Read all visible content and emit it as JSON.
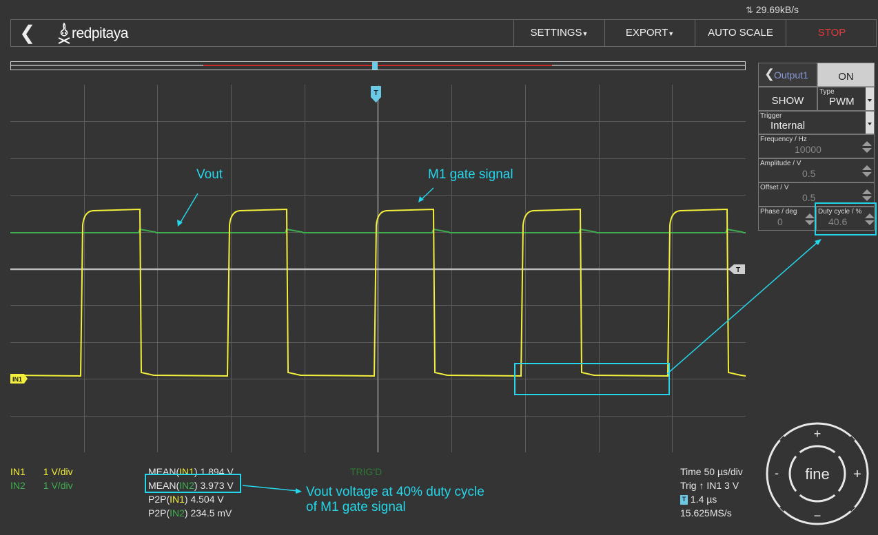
{
  "status": {
    "speed": "29.69kB/s"
  },
  "header": {
    "brand": "redpitaya",
    "settings": "SETTINGS",
    "export": "EXPORT",
    "autoscale": "AUTO SCALE",
    "stop": "STOP"
  },
  "scope": {
    "trigger_marker": "T",
    "trigger_level_marker": "T",
    "channel_marker": "IN1",
    "annotations": {
      "vout": "Vout",
      "gate": "M1 gate signal"
    }
  },
  "panel": {
    "output_label": "Output1",
    "on_label": "ON",
    "show_label": "SHOW",
    "type_label": "Type",
    "type_value": "PWM",
    "trigger_label": "Trigger",
    "trigger_value": "Internal",
    "frequency_label": "Frequency / Hz",
    "frequency_value": "10000",
    "amplitude_label": "Amplitude / V",
    "amplitude_value": "0.5",
    "offset_label": "Offset / V",
    "offset_value": "0.5",
    "phase_label": "Phase / deg",
    "phase_value": "0",
    "duty_label": "Duty cycle / %",
    "duty_value": "40.6"
  },
  "channels": [
    {
      "name": "IN1",
      "scale": "1 V/div",
      "color": "#f4ef3b"
    },
    {
      "name": "IN2",
      "scale": "1 V/div",
      "color": "#3fae4f"
    }
  ],
  "measurements": {
    "mean_in1_prefix": "MEAN(",
    "mean_in1_ch": "IN1",
    "mean_in1_value": ") 1.894 V",
    "mean_in2_prefix": "MEAN(",
    "mean_in2_ch": "IN2",
    "mean_in2_value": ") 3.973 V",
    "p2p_in1_prefix": "P2P(",
    "p2p_in1_ch": "IN1",
    "p2p_in1_value": ") 4.504 V",
    "p2p_in2_prefix": "P2P(",
    "p2p_in2_ch": "IN2",
    "p2p_in2_value": ") 234.5 mV"
  },
  "trig_status": "TRIG'D",
  "timebase": {
    "time": "Time 50 µs/div",
    "trig": "Trig ↑ IN1 3 V",
    "offset": "1.4 µs",
    "samplerate": "15.625MS/s",
    "offset_marker": "T"
  },
  "annotation_note": {
    "line1": "Vout voltage at 40% duty cycle",
    "line2": "of M1 gate signal"
  },
  "dial": {
    "center": "fine",
    "plus_top": "+",
    "minus_bottom": "−",
    "minus_left": "-",
    "plus_right": "+"
  },
  "colors": {
    "in1": "#f4ef3b",
    "in2": "#3fae4f",
    "stop": "#e23b3b",
    "annotation": "#25d6ea",
    "trigger": "#6cc9e6"
  }
}
